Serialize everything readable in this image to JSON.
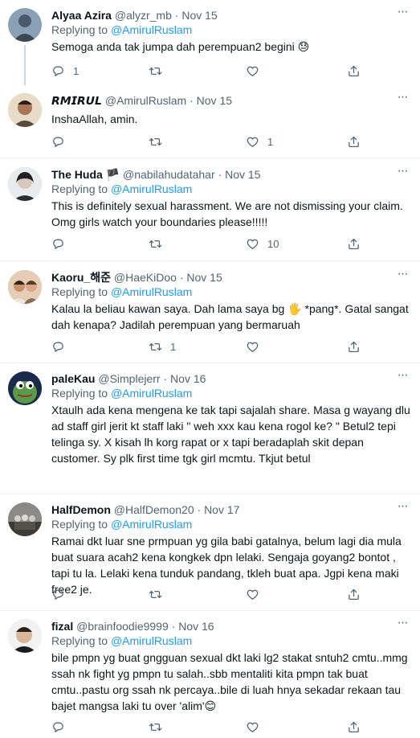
{
  "reply_prefix": "Replying to",
  "menu_glyph": "···",
  "tweets": [
    {
      "name": "Alyaa Azira",
      "handle": "@alyzr_mb",
      "dot": "·",
      "date": "Nov 15",
      "reply_to": "@AmirulRuslam",
      "text": "Semoga anda tak jumpa dah perempuan2 begini 😓",
      "replies": "1",
      "retweets": "",
      "likes": "",
      "avatar_color": "#8aa0b4"
    },
    {
      "name": "𝙍𝙈𝙄𝙍𝙐𝙇",
      "handle": "@AmirulRuslam",
      "dot": "·",
      "date": "Nov 15",
      "reply_to": "",
      "text": "InshaAllah, amin.",
      "replies": "",
      "retweets": "",
      "likes": "1",
      "avatar_color": "#b98a6e"
    },
    {
      "name": "The Huda 🏴",
      "handle": "@nabilahudatahar",
      "dot": "·",
      "date": "Nov 15",
      "reply_to": "@AmirulRuslam",
      "text": "This is definitely sexual harassment. We are not dismissing your claim. Omg girls watch your boundaries please!!!!!",
      "replies": "",
      "retweets": "",
      "likes": "10",
      "avatar_color": "#9aa3a8"
    },
    {
      "name": "Kaoru_해준",
      "handle": "@HaeKiDoo",
      "dot": "·",
      "date": "Nov 15",
      "reply_to": "@AmirulRuslam",
      "text": "Kalau la beliau kawan saya. Dah lama saya bg 🖐 *pang*. Gatal sangat dah kenapa? Jadilah perempuan yang bermaruah",
      "replies": "",
      "retweets": "1",
      "likes": "",
      "avatar_color": "#c49a7a"
    },
    {
      "name": "paleKau",
      "handle": "@Simplejerr",
      "dot": "·",
      "date": "Nov 16",
      "reply_to": "@AmirulRuslam",
      "text": "Xtaulh ada kena mengena ke tak tapi sajalah share. Masa g wayang dlu ad staff girl jerit kt staff laki \" weh xxx kau kena rogol ke? \" Betul2 tepi telinga sy. X kisah lh korg rapat or x tapi beradaplah skit depan customer. Sy plk first time tgk girl mcmtu. Tkjut betul",
      "replies": "",
      "retweets": "",
      "likes": "",
      "avatar_color": "#3f7d3a"
    },
    {
      "name": "HalfDemon",
      "handle": "@HalfDemon20",
      "dot": "·",
      "date": "Nov 17",
      "reply_to": "@AmirulRuslam",
      "text": "Ramai dkt luar sne prmpuan yg gila babi gatalnya, belum lagi dia mula buat suara acah2 kena kongkek dpn lelaki. Sengaja goyang2 bontot , tapi tu la. Lelaki kena tunduk pandang, tkleh buat apa. Jgpi kena maki free2 je.",
      "replies": "",
      "retweets": "",
      "likes": "",
      "avatar_color": "#6d6a66"
    },
    {
      "name": "fizal",
      "handle": "@brainfoodie9999",
      "dot": "·",
      "date": "Nov 16",
      "reply_to": "@AmirulRuslam",
      "text": "bile pmpn yg buat gngguan sexual dkt laki lg2 stakat sntuh2 cmtu..mmg ssah nk fight yg pmpn tu salah..sbb mentaliti kita pmpn tak buat cmtu..pastu org ssah nk percaya..bile di luah hnya sekadar rekaan tau bajet mangsa laki tu over 'alim'😊",
      "replies": "",
      "retweets": "",
      "likes": "",
      "avatar_color": "#c9c9c9"
    }
  ]
}
